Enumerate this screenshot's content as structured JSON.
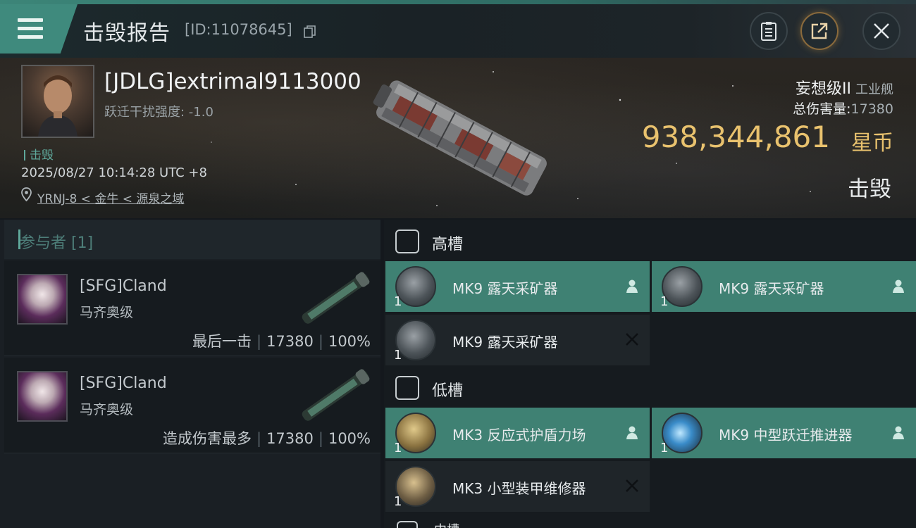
{
  "header": {
    "title": "击毁报告",
    "kill_id": "[ID:11078645]",
    "icons": [
      "menu-icon",
      "copy-icon",
      "clipboard-icon",
      "share-icon",
      "close-icon"
    ]
  },
  "victim": {
    "name": "[JDLG]extrimal9113000",
    "warp_scramble": "跃迁干扰强度: -1.0",
    "tag": "击毁",
    "timestamp": "2025/08/27 10:14:28 UTC +8",
    "location": "YRNJ-8 < 金牛 < 源泉之域",
    "ship_class": "妄想级II",
    "ship_type": "工业舰",
    "total_damage_label": "总伤害量:",
    "total_damage": "17380",
    "isk_value": "938,344,861",
    "isk_unit": "星币",
    "status": "击毁"
  },
  "participants": {
    "header": "参与者 [1]",
    "rows": [
      {
        "name": "[SFG]Cland",
        "ship": "马齐奥级",
        "role": "最后一击",
        "damage": "17380",
        "percent": "100%"
      },
      {
        "name": "[SFG]Cland",
        "ship": "马齐奥级",
        "role": "造成伤害最多",
        "damage": "17380",
        "percent": "100%"
      }
    ]
  },
  "fitting": {
    "high": {
      "label": "高槽",
      "modules": [
        {
          "name": "MK9 露天采矿器",
          "qty": "1",
          "state": "fitted"
        },
        {
          "name": "MK9 露天采矿器",
          "qty": "1",
          "state": "fitted"
        },
        {
          "name": "MK9 露天采矿器",
          "qty": "1",
          "state": "destroyed"
        }
      ]
    },
    "low": {
      "label": "低槽",
      "modules": [
        {
          "name": "MK3 反应式护盾力场",
          "qty": "1",
          "state": "fitted"
        },
        {
          "name": "MK9 中型跃迁推进器",
          "qty": "1",
          "state": "fitted"
        },
        {
          "name": "MK3 小型装甲维修器",
          "qty": "1",
          "state": "destroyed"
        }
      ]
    },
    "next_label": "中槽"
  },
  "colors": {
    "accent": "#3f8a7d",
    "isk_gold": "#e9c26e",
    "fitted_bg": "#3f8173",
    "destroyed_bg": "#1f2529"
  }
}
